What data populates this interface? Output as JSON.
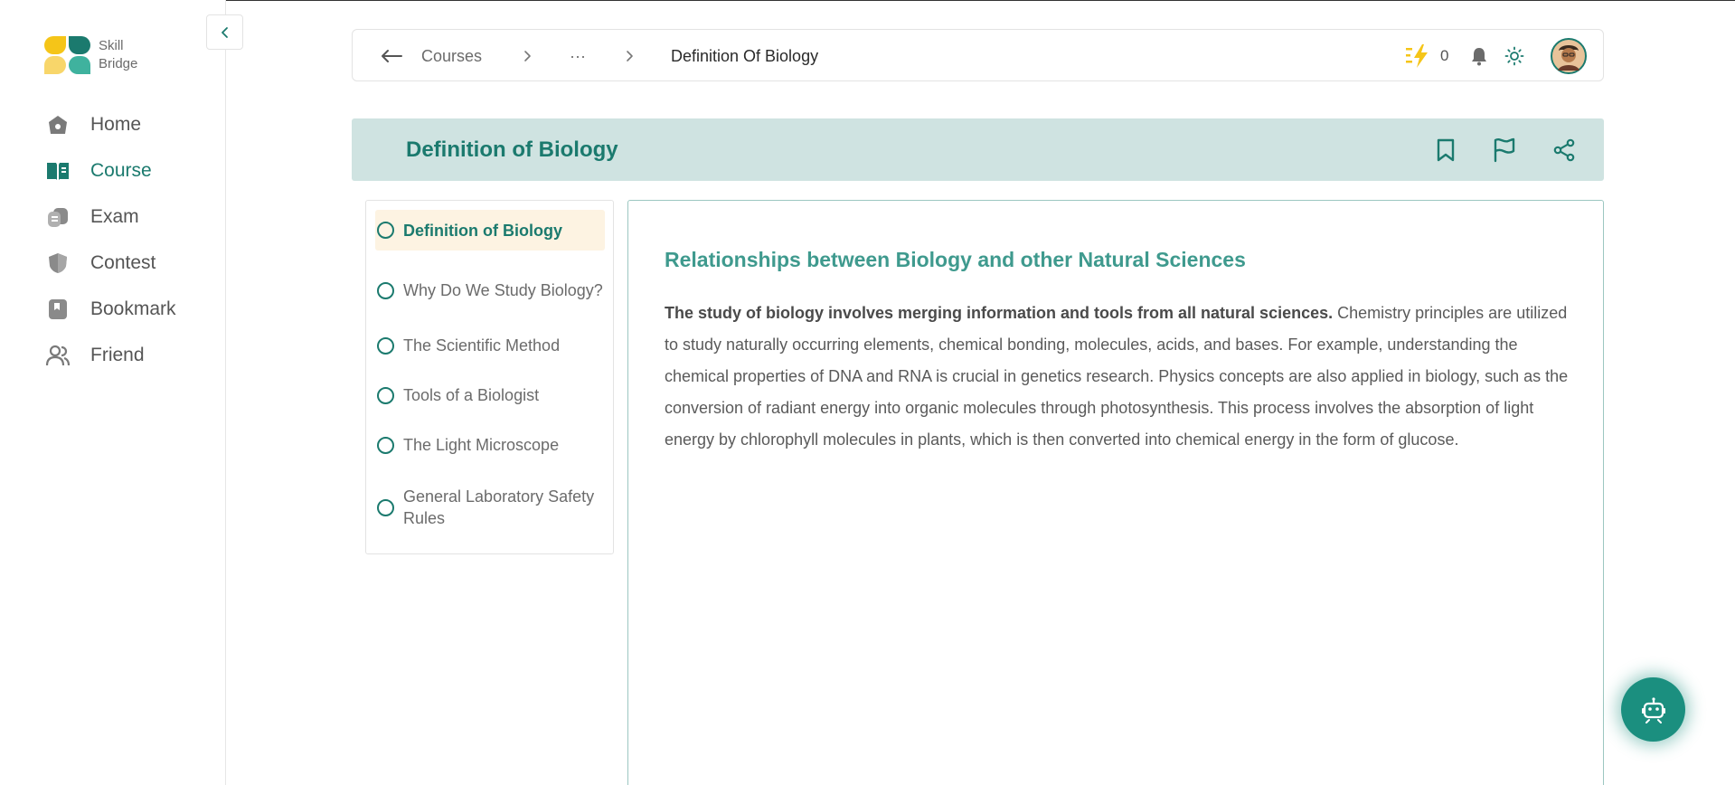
{
  "app": {
    "logo_line1": "Skill",
    "logo_line2": "Bridge"
  },
  "sidebar": {
    "items": [
      {
        "label": "Home",
        "icon": "home-icon"
      },
      {
        "label": "Course",
        "icon": "book-open-icon",
        "active": true
      },
      {
        "label": "Exam",
        "icon": "exam-icon"
      },
      {
        "label": "Contest",
        "icon": "contest-shield-icon"
      },
      {
        "label": "Bookmark",
        "icon": "bookmark-icon"
      },
      {
        "label": "Friend",
        "icon": "friends-icon"
      }
    ]
  },
  "header": {
    "back_icon": "arrow-left-icon",
    "crumb_courses": "Courses",
    "crumb_ellipsis": "···",
    "crumb_current": "Definition Of Biology",
    "energy_count": "0",
    "icons": [
      "lightning-icon",
      "bell-icon",
      "sun-icon",
      "avatar"
    ]
  },
  "lesson": {
    "title": "Definition of Biology",
    "actions": [
      "bookmark-icon",
      "flag-icon",
      "share-icon"
    ]
  },
  "lesson_list": {
    "items": [
      {
        "label": "Definition of Biology",
        "active": true
      },
      {
        "label": "Why Do We Study Biology?"
      },
      {
        "label": "The Scientific Method"
      },
      {
        "label": "Tools of a Biologist"
      },
      {
        "label": "The Light Microscope"
      },
      {
        "label": "General Laboratory Safety Rules"
      }
    ]
  },
  "content": {
    "heading": "Relationships between Biology and other Natural Sciences",
    "lead_bold": "The study of biology involves merging information and tools from all natural sciences.",
    "body": " Chemistry principles are utilized to study naturally occurring elements, chemical bonding, molecules, acids, and bases. For example, understanding the chemical properties of DNA and RNA is crucial in genetics research. Physics concepts are also applied in biology, such as the conversion of radiant energy into organic molecules through photosynthesis. This process involves the absorption of light energy by chlorophyll molecules in plants, which is then converted into chemical energy in the form of glucose."
  },
  "colors": {
    "accent": "#1b7a6e",
    "accent_light": "#3f9a8e",
    "band_bg": "#cfe3e1",
    "active_item_bg": "#fdf3e2",
    "logo_yellow": "#f5c518",
    "logo_teal": "#1b7a6e"
  }
}
